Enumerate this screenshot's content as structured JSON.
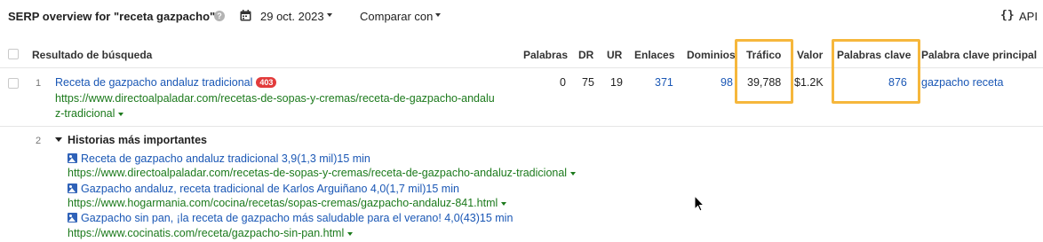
{
  "header": {
    "title": "SERP overview for \"receta gazpacho\"",
    "help_icon": "?",
    "date": "29 oct. 2023",
    "compare_label": "Comparar con",
    "api_icon_text": "{}",
    "api_label": "API"
  },
  "table": {
    "columns": {
      "result": "Resultado de búsqueda",
      "words": "Palabras",
      "dr": "DR",
      "ur": "UR",
      "links": "Enlaces",
      "domains": "Dominios",
      "traffic": "Tráfico",
      "value": "Valor",
      "keywords": "Palabras clave",
      "top_keyword": "Palabra clave principal"
    },
    "row1": {
      "position": "1",
      "title": "Receta de gazpacho andaluz tradicional",
      "badge": "403",
      "url_line1": "https://www.directoalpaladar.com/recetas-de-sopas-y-cremas/receta-de-gazpacho-andalu",
      "url_line2": "z-tradicional",
      "words": "0",
      "dr": "75",
      "ur": "19",
      "links": "371",
      "domains": "98",
      "traffic": "39,788",
      "value": "$1.2K",
      "keywords": "876",
      "top_keyword": "gazpacho receta"
    },
    "row2": {
      "position": "2",
      "section_title": "Historias más importantes",
      "stories": [
        {
          "title": "Receta de gazpacho andaluz tradicional 3,9(1,3 mil)15 min",
          "url": "https://www.directoalpaladar.com/recetas-de-sopas-y-cremas/receta-de-gazpacho-andaluz-tradicional"
        },
        {
          "title": "Gazpacho andaluz, receta tradicional de Karlos Arguiñano 4,0(1,7 mil)15 min",
          "url": "https://www.hogarmania.com/cocina/recetas/sopas-cremas/gazpacho-andaluz-841.html"
        },
        {
          "title": "Gazpacho sin pan, ¡la receta de gazpacho más saludable para el verano! 4,0(43)15 min",
          "url": "https://www.cocinatis.com/receta/gazpacho-sin-pan.html"
        }
      ]
    }
  },
  "colors": {
    "link": "#1a57b5",
    "url": "#1c7a1c",
    "badge": "#e23b3b",
    "highlight": "#f6b73c"
  }
}
